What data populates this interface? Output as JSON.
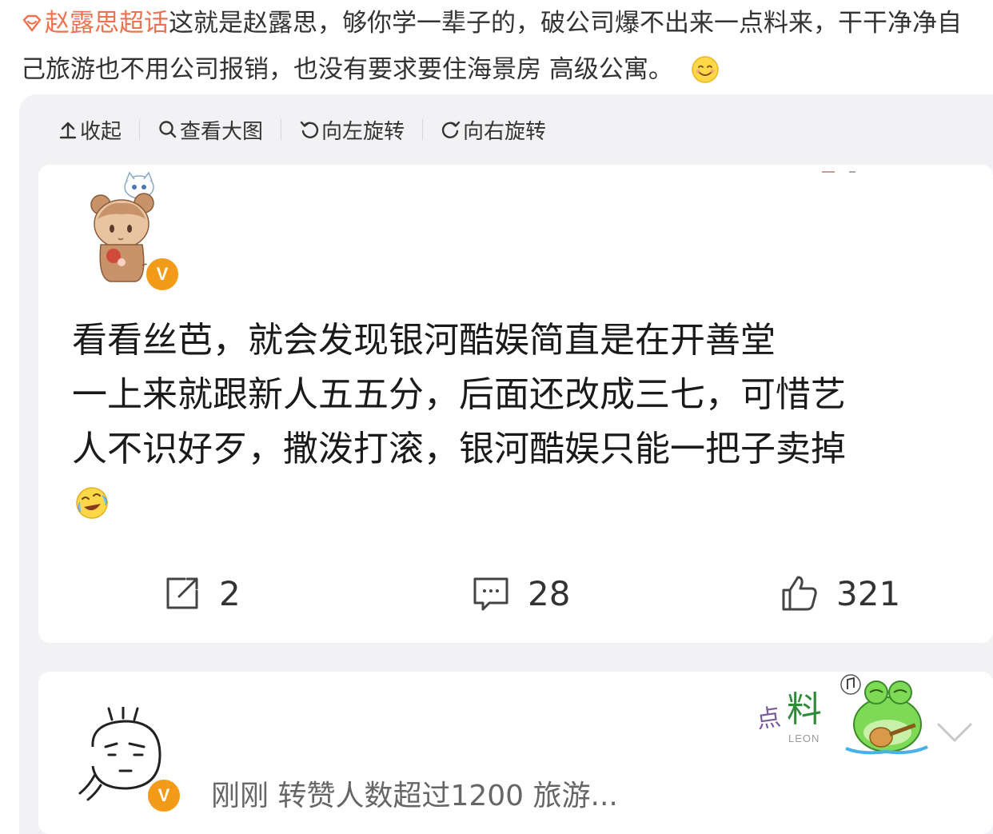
{
  "post": {
    "topic": "赵露思超话",
    "line1_rest": "这就是赵露思，够你学一辈子的，破公司爆不出来一点料来，干干净净自",
    "line2": "己旅游也不用公司报销，也没有要求要住海景房 高级公寓。",
    "smile_emoji": "smile-emoji"
  },
  "toolbar": {
    "collapse": "收起",
    "view_large": "查看大图",
    "rotate_left": "向左旋转",
    "rotate_right": "向右旋转"
  },
  "card1": {
    "verified_badge": "V",
    "lines": [
      "看看丝芭，就会发现银河酷娱简直是在开善堂",
      "一上来就跟新人五五分，后面还改成三七，可惜艺",
      "人不识好歹，撒泼打滚，银河酷娱只能一把子卖掉"
    ],
    "reposts": "2",
    "comments": "28",
    "likes": "321"
  },
  "card2": {
    "verified_badge": "V",
    "meta": "刚刚 转赞人数超过1200  旅游...",
    "sticker_text": "点料",
    "sticker_sub": "LEON"
  },
  "colors": {
    "topic": "#eb7350",
    "badge": "#f49a19",
    "panel_bg": "#f2f2f5"
  }
}
